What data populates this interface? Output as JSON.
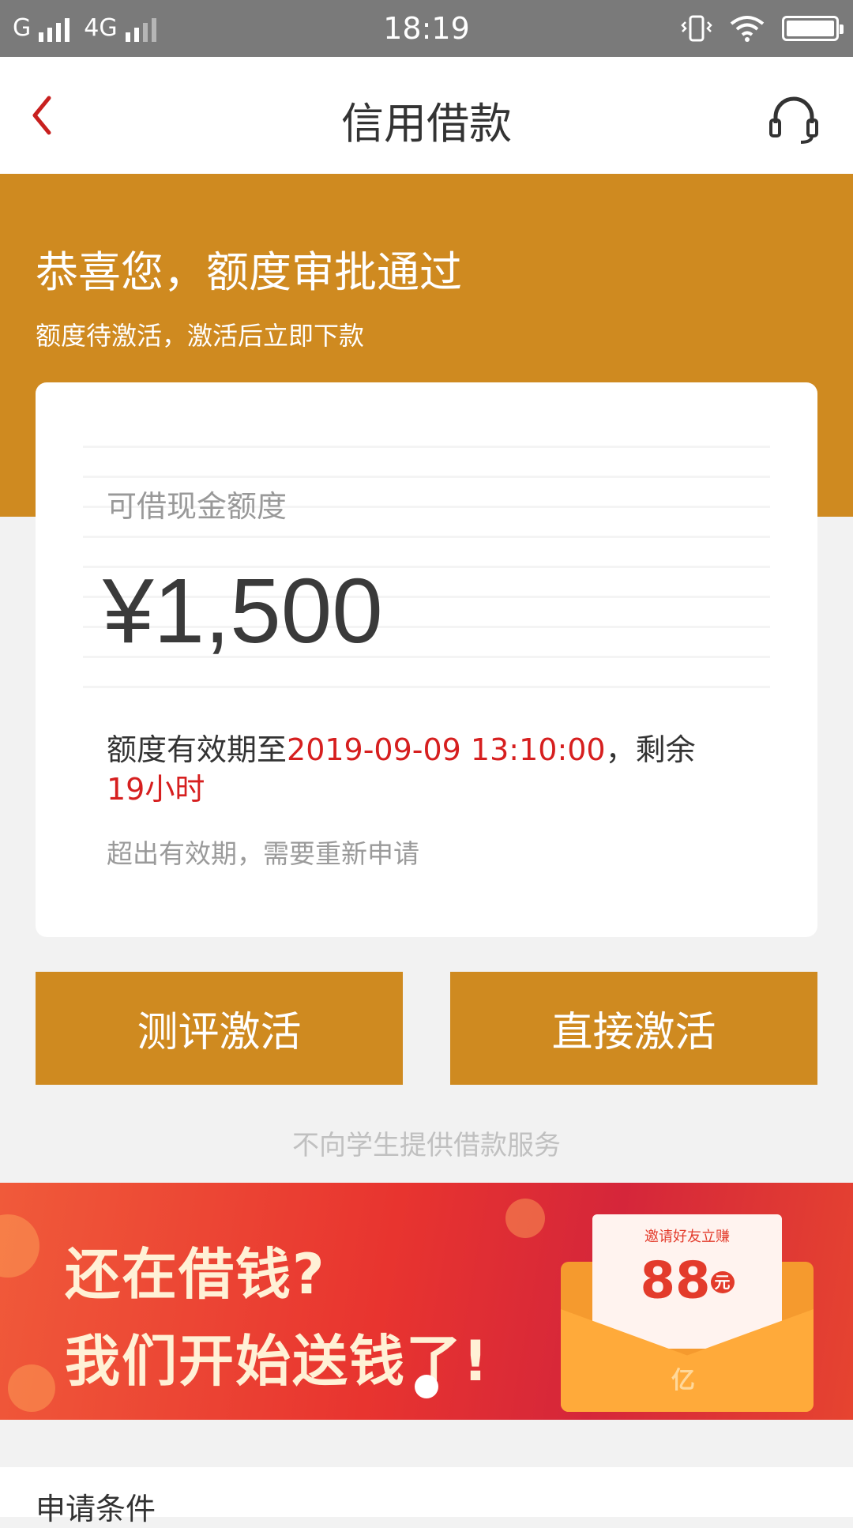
{
  "status_bar": {
    "carrier1": "G",
    "carrier2": "4G",
    "time": "18:19"
  },
  "nav": {
    "title": "信用借款"
  },
  "hero": {
    "title": "恭喜您，额度审批通过",
    "subtitle": "额度待激活，激活后立即下款"
  },
  "card": {
    "amount_label": "可借现金额度",
    "amount": "¥1,500",
    "validity_prefix": "额度有效期至",
    "validity_date": "2019-09-09 13:10:00",
    "validity_sep": "，剩余",
    "validity_remaining": "19小时",
    "note": "超出有效期，需要重新申请"
  },
  "buttons": {
    "assess_activate": "测评激活",
    "direct_activate": "直接激活"
  },
  "disclaimer": "不向学生提供借款服务",
  "banner": {
    "line1": "还在借钱?",
    "line2": "我们开始送钱了!",
    "card_title": "邀请好友立赚",
    "card_amount": "88",
    "card_unit": "元",
    "envelope_mark": "亿"
  },
  "section": {
    "title": "申请条件"
  },
  "colors": {
    "brand_orange": "#cf8a20",
    "accent_red": "#d61f1f",
    "back_arrow_red": "#c8201f"
  }
}
